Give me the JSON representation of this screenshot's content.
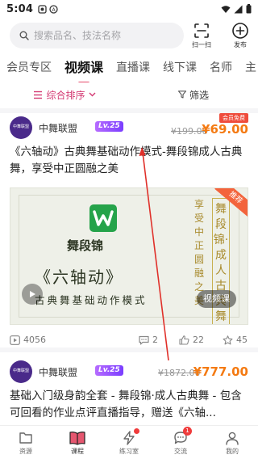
{
  "status_bar": {
    "time": "5:04"
  },
  "search": {
    "placeholder": "搜索品名、技法名称",
    "icon": "search-icon"
  },
  "header_buttons": {
    "scan_label": "扫一扫",
    "publish_label": "发布"
  },
  "tabs": [
    {
      "label": "会员专区"
    },
    {
      "label": "视频课",
      "active": true
    },
    {
      "label": "直播课"
    },
    {
      "label": "线下课"
    },
    {
      "label": "名师"
    },
    {
      "label": "主"
    }
  ],
  "filters": {
    "sort_label": "综合排序",
    "screen_label": "筛选"
  },
  "colors": {
    "accent": "#d43a73",
    "price": "#f47a12",
    "lv_badge": "#9950ff"
  },
  "cards": [
    {
      "avatar_text": "中舞联盟",
      "org_name": "中舞联盟",
      "level": "Lv.25",
      "member_tag": "会员免费",
      "old_price": "¥199.00",
      "new_price": "¥69.00",
      "title": "《六轴动》古典舞基础动作模式-舞段锦成人古典舞，享受中正圆融之美",
      "thumbnail": {
        "brand": "舞段锦",
        "course": "《六轴动》",
        "subtitle": "古典舞基础动作模式",
        "vertical_1": "享受中正圆融之美",
        "vertical_2": "舞段锦·成人古典舞",
        "hot_badge": "推荐",
        "video_tag": "视频课"
      },
      "stats": {
        "plays": "4056",
        "comments": "2",
        "likes": "22",
        "favorites": "45"
      }
    },
    {
      "avatar_text": "中舞联盟",
      "org_name": "中舞联盟",
      "level": "Lv.25",
      "old_price": "¥1872.00",
      "new_price": "¥777.00",
      "title": "基础入门级身韵全套 - 舞段锦·成人古典舞 - 包含可回看的作业点评直播指导，赠送《六轴..."
    }
  ],
  "bottom_nav": [
    {
      "label": "资源",
      "icon": "resource-icon"
    },
    {
      "label": "课程",
      "icon": "course-book-icon",
      "active": true
    },
    {
      "label": "练习室",
      "icon": "lightning-icon",
      "has_dot": true
    },
    {
      "label": "交流",
      "icon": "chat-icon",
      "badge": "1"
    },
    {
      "label": "我的",
      "icon": "user-icon"
    }
  ]
}
